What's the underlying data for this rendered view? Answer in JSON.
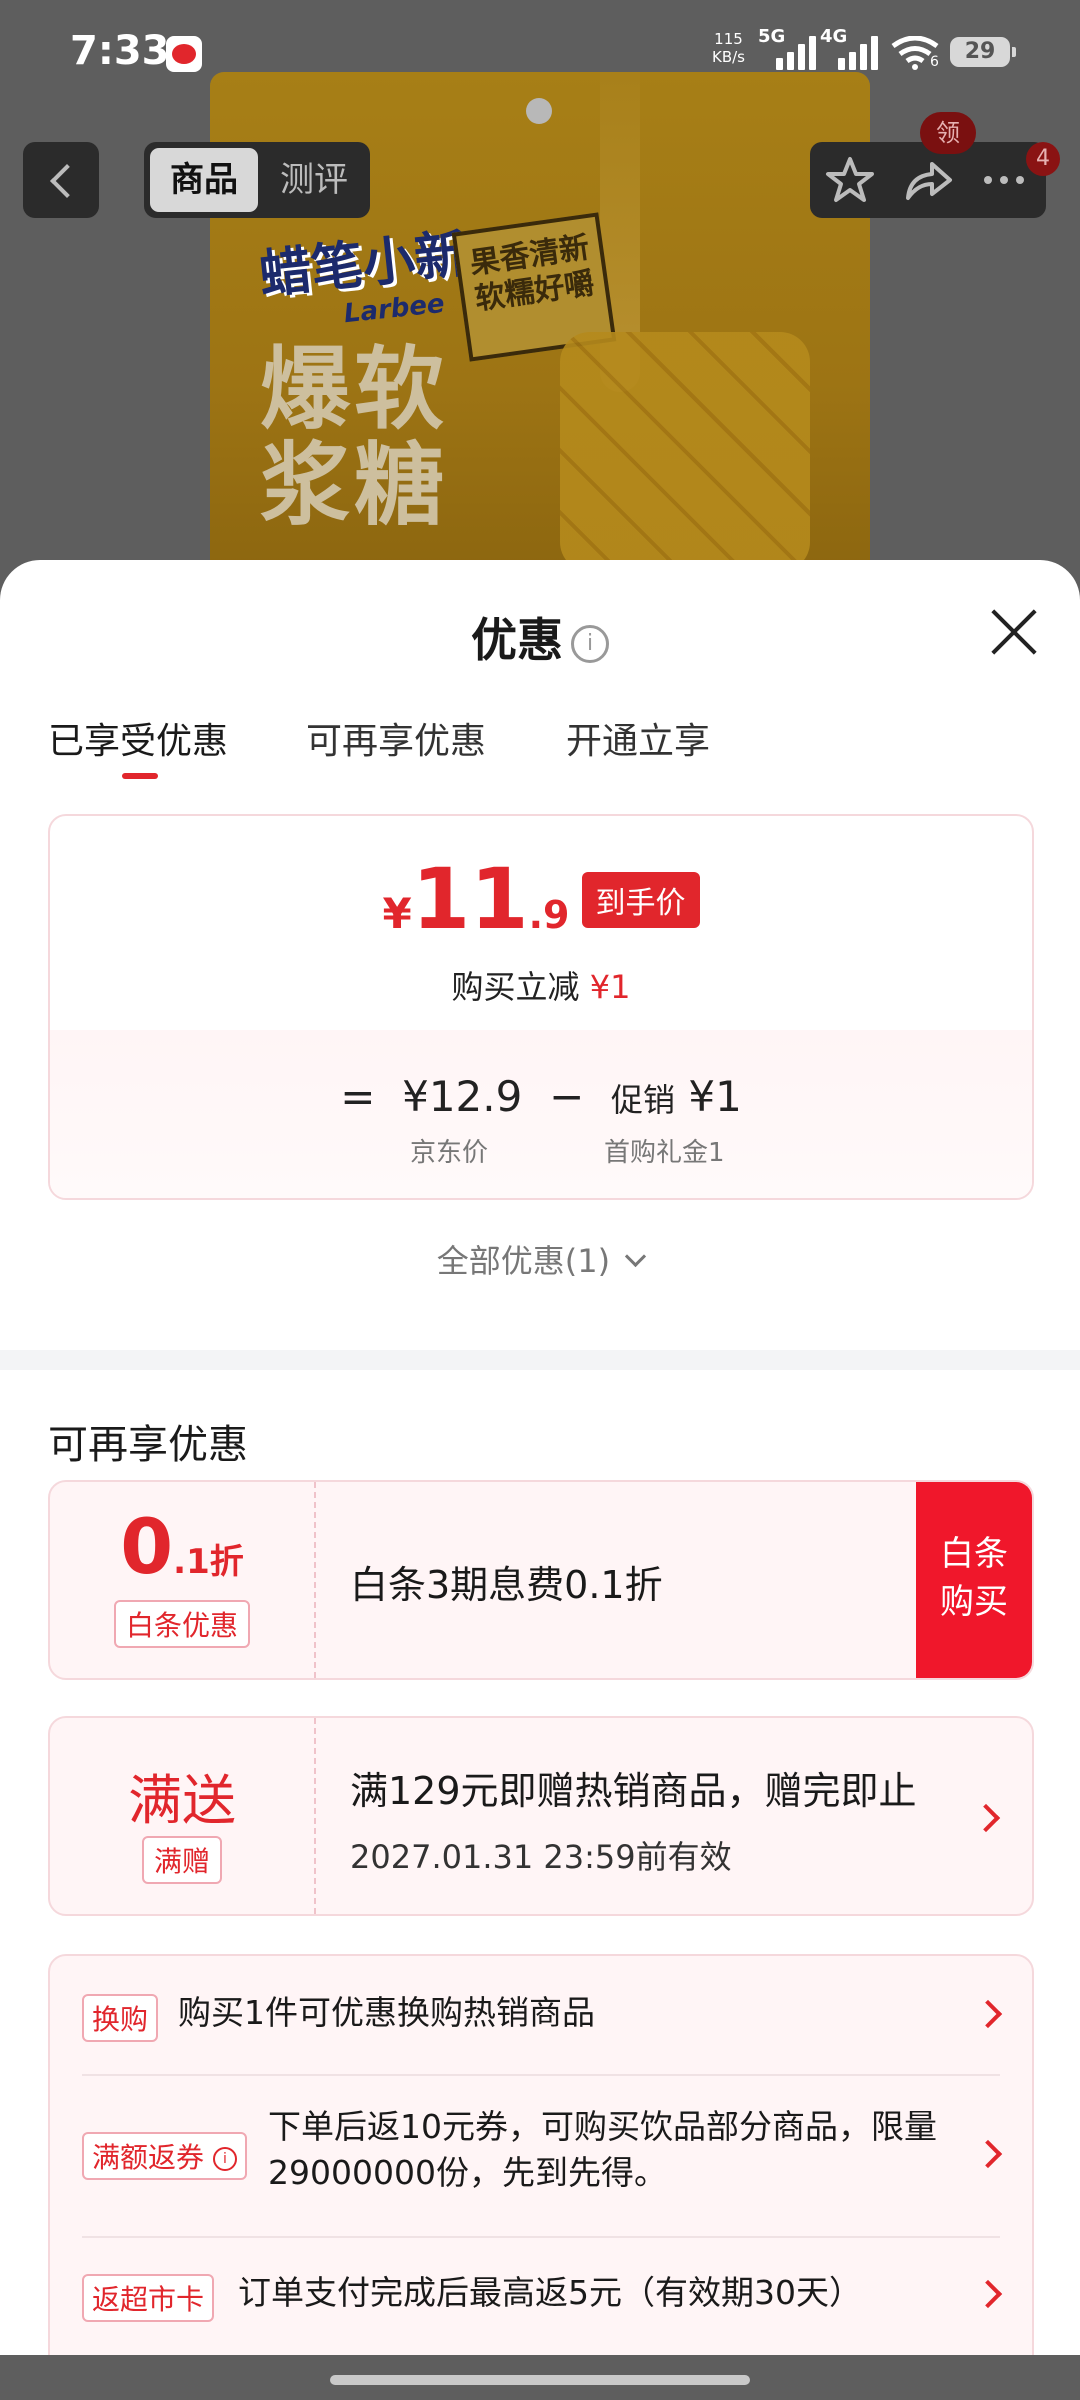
{
  "status_bar": {
    "time": "7:33",
    "speed_value": "115",
    "speed_unit": "KB/s",
    "net1": "5G",
    "net2": "4G",
    "wifi_sub": "6",
    "battery": "29"
  },
  "product_image": {
    "brand": "蜡笔小新",
    "brand_en": "Larbee",
    "slogan": "果香清新 软糯好嚼",
    "name_line1": "爆软",
    "name_line2": "浆糖"
  },
  "nav": {
    "tab_goods": "商品",
    "tab_review": "测评",
    "coupon_badge": "领",
    "message_count": "4"
  },
  "sheet": {
    "title": "优惠",
    "info_icon": "i",
    "tabs": [
      "已享受优惠",
      "可再享优惠",
      "开通立享"
    ],
    "price_card": {
      "yen": "¥",
      "price_int": "11",
      "price_dec": ".9",
      "price_tag": "到手价",
      "reduce_label": "购买立减",
      "reduce_value": "¥1",
      "eq": "=",
      "base_price": "¥12.9",
      "minus": "−",
      "promo_label": "促销",
      "promo_value": "¥1",
      "base_label": "京东价",
      "promo_sub": "首购礼金1"
    },
    "all_coupons": "全部优惠(1)",
    "section_title": "可再享优惠",
    "baitiao": {
      "value_big": "0",
      "value_small": ".1折",
      "tag": "白条优惠",
      "desc": "白条3期息费0.1折",
      "button": "白条\n购买"
    },
    "manzeng": {
      "big": "满送",
      "tag": "满赠",
      "desc": "满129元即赠热销商品，赠完即止",
      "valid": "2027.01.31 23:59前有效"
    },
    "rows": [
      {
        "tag": "换购",
        "text": "购买1件可优惠换购热销商品"
      },
      {
        "tag": "满额返券",
        "text": "下单后返10元券，可购买饮品部分商品，限量29000000份，先到先得。"
      },
      {
        "tag": "返超市卡",
        "text": "订单支付完成后最高返5元（有效期30天）"
      }
    ]
  },
  "colors": {
    "accent": "#e1262c",
    "button_red": "#f0172b",
    "overlay": "#5e5e5e"
  }
}
